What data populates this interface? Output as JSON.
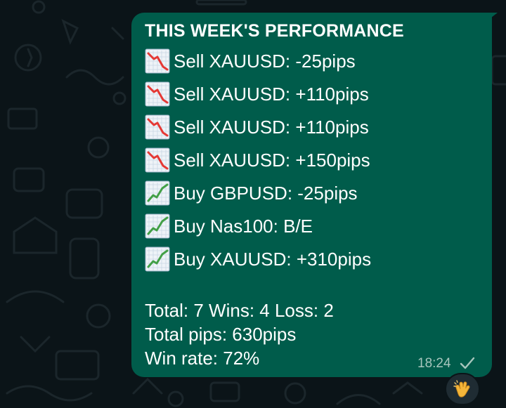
{
  "message": {
    "title": "THIS WEEK'S PERFORMANCE",
    "trades": [
      {
        "icon": "chart-decreasing-icon",
        "text": "Sell XAUUSD: -25pips"
      },
      {
        "icon": "chart-decreasing-icon",
        "text": "Sell XAUUSD: +110pips"
      },
      {
        "icon": "chart-decreasing-icon",
        "text": "Sell XAUUSD: +110pips"
      },
      {
        "icon": "chart-decreasing-icon",
        "text": "Sell XAUUSD: +150pips"
      },
      {
        "icon": "chart-increasing-icon",
        "text": "Buy GBPUSD: -25pips"
      },
      {
        "icon": "chart-increasing-icon",
        "text": "Buy Nas100: B/E"
      },
      {
        "icon": "chart-increasing-icon",
        "text": "Buy XAUUSD: +310pips"
      }
    ],
    "summary": {
      "totals": "Total: 7 Wins: 4 Loss: 2",
      "pips": "Total pips: 630pips",
      "winrate": "Win rate: 72%"
    },
    "time": "18:24",
    "status_icon": "single-check-icon",
    "reaction_icon": "clapping-hands-icon"
  },
  "colors": {
    "background": "#0b1418",
    "bubble": "#005c4b",
    "text": "#ffffff",
    "timestamp": "#a7c6bd",
    "down_line": "#e53935",
    "up_line": "#43a047"
  }
}
